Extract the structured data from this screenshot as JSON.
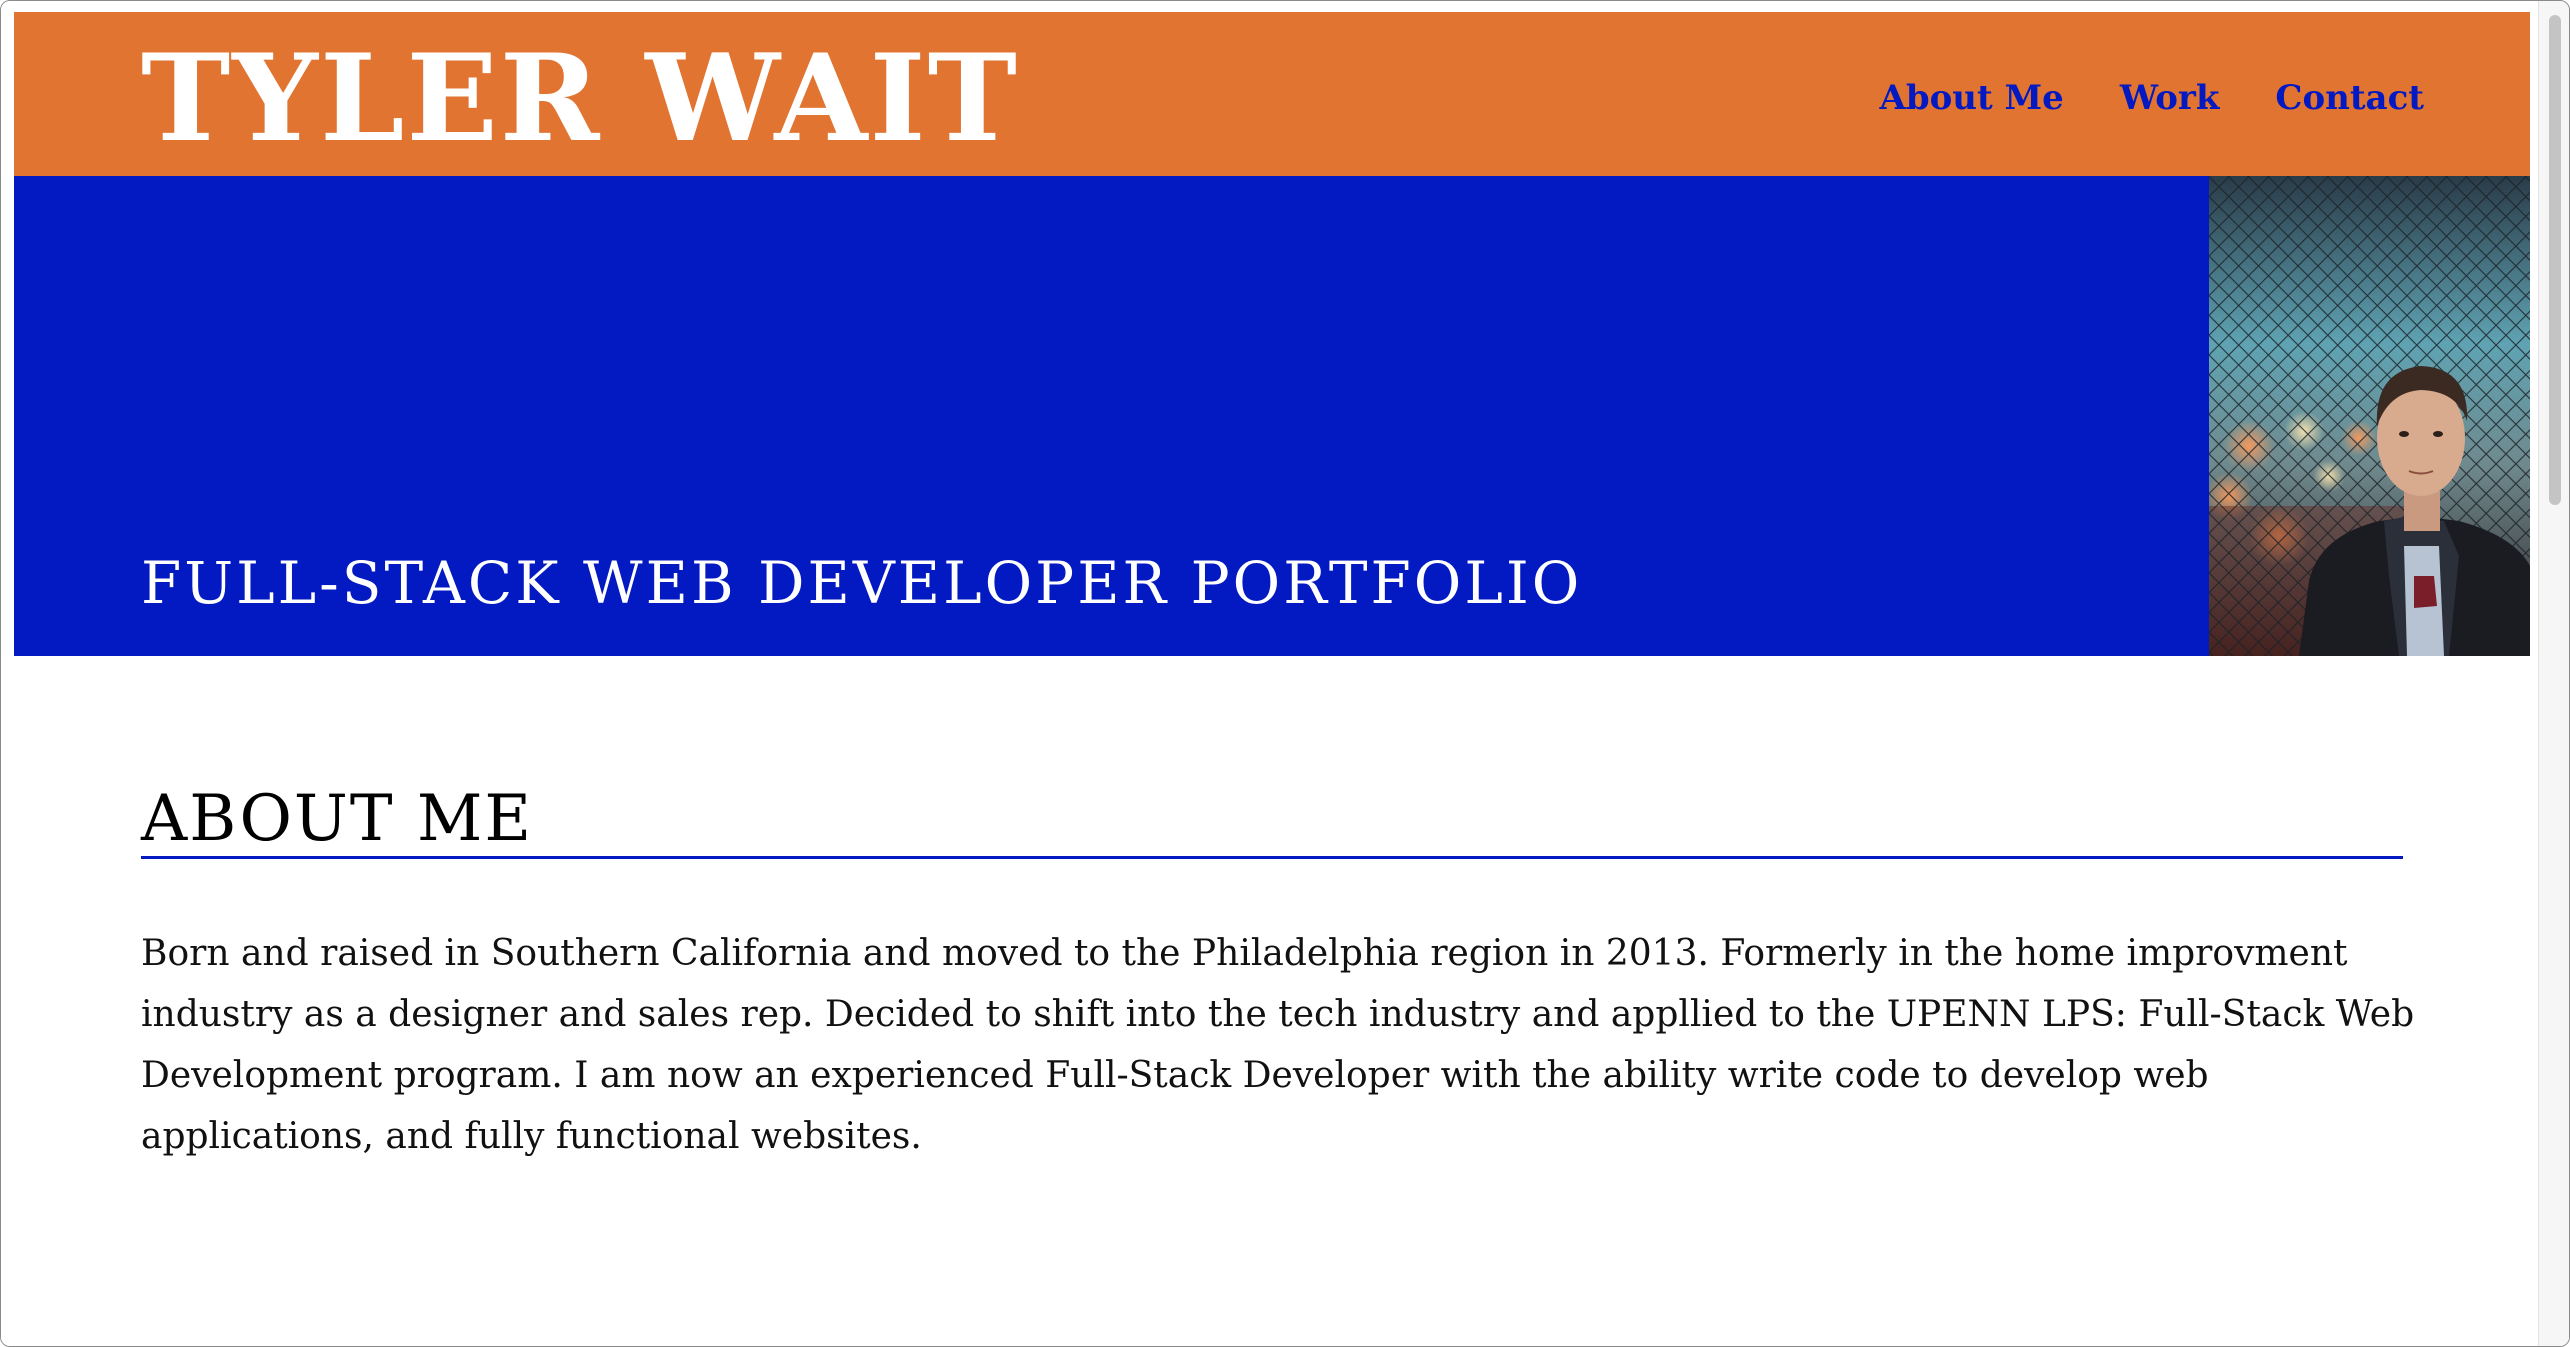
{
  "header": {
    "title": "TYLER WAIT",
    "nav": [
      {
        "label": "About Me"
      },
      {
        "label": "Work"
      },
      {
        "label": "Contact"
      }
    ]
  },
  "hero": {
    "subtitle": "FULL-STACK WEB DEVELOPER PORTFOLIO",
    "photo_icon": "profile-photo"
  },
  "about": {
    "heading": "ABOUT ME",
    "body": "Born and raised in Southern California and moved to the Philadelphia region in 2013. Formerly in the home improvment industry as a designer and sales rep. Decided to shift into the tech industry and appllied to the UPENN LPS: Full-Stack Web Development program. I am now an experienced Full-Stack Developer with the ability write code to develop web applications, and fully functional websites."
  },
  "colors": {
    "header_bg": "#e27431",
    "hero_bg": "#0319c1",
    "nav_link": "#0319c1",
    "rule": "#0319c1"
  }
}
